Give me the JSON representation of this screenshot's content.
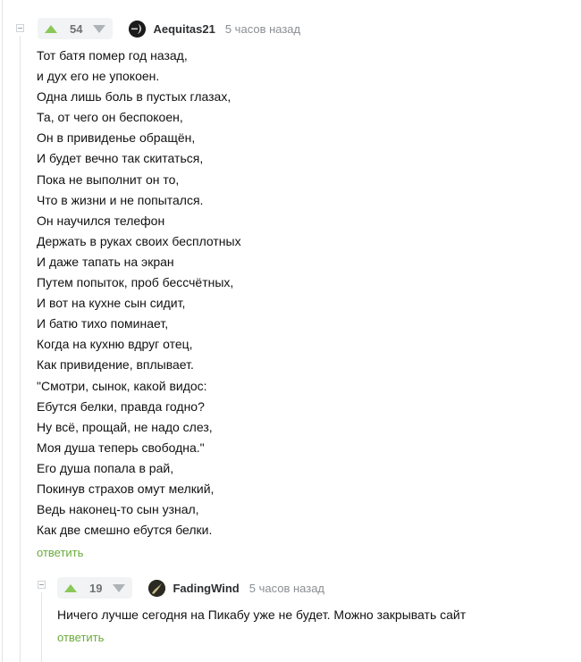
{
  "comment": {
    "rating": "54",
    "username": "Aequitas21",
    "timestamp": "5 часов назад",
    "lines": [
      "Тот батя помер год назад,",
      "и дух его не упокоен.",
      "Одна лишь боль в пустых глазах,",
      "Та, от чего он беспокоен,",
      "Он в привиденье обращён,",
      "И будет вечно так скитаться,",
      "Пока не выполнит он то,",
      "Что в жизни и не попытался.",
      "Он научился телефон",
      "Держать в руках своих бесплотных",
      "И даже тапать на экран",
      "Путем попыток, проб бессчётных,",
      "И вот на кухне сын сидит,",
      "И батю тихо поминает,",
      "Когда на кухню вдруг отец,",
      "Как привидение, вплывает.",
      "\"Смотри, сынок, какой видос:",
      "Ебутся белки, правда годно?",
      "Ну всё, прощай, не надо слез,",
      "Моя душа теперь свободна.\"",
      "Его душа попала в рай,",
      "Покинув страхов омут мелкий,",
      "Ведь наконец-то сын узнал,",
      "Как две смешно ебутся белки."
    ],
    "reply_label": "ответить"
  },
  "reply": {
    "rating": "19",
    "username": "FadingWind",
    "timestamp": "5 часов назад",
    "text": "Ничего лучше сегодня на Пикабу уже не будет. Можно закрывать сайт",
    "reply_label": "ответить"
  },
  "colors": {
    "upvote": "#8ac858",
    "downvote": "#aeb3b8",
    "reply_link": "#6aab3b",
    "thread_line": "#e2e4e6"
  }
}
